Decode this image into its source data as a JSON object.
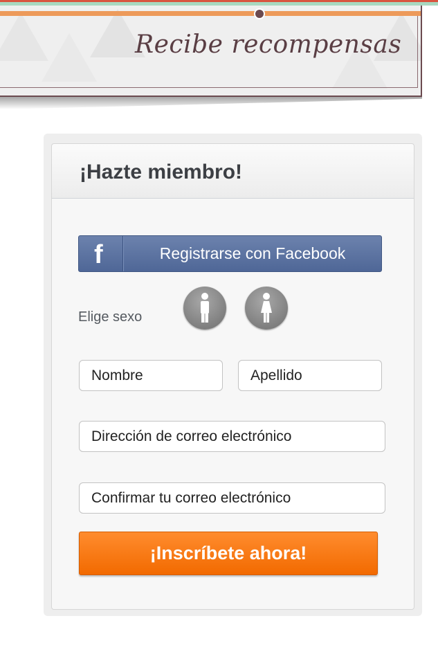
{
  "banner": {
    "title": "Recibe recompensas"
  },
  "form": {
    "title": "¡Hazte miembro!",
    "facebook_button": "Registrarse con Facebook",
    "facebook_icon": "f",
    "gender_label": "Elige sexo",
    "gender_options": [
      "male-icon",
      "female-icon"
    ],
    "first_name_placeholder": "Nombre",
    "last_name_placeholder": "Apellido",
    "email_placeholder": "Dirección de correo electrónico",
    "email_confirm_placeholder": "Confirmar tu correo electrónico",
    "submit_button": "¡Inscríbete ahora!"
  },
  "colors": {
    "facebook": "#5a71a0",
    "submit": "#f77a12",
    "banner_accent": "#ed9a5a",
    "banner_text": "#5a3e44"
  }
}
